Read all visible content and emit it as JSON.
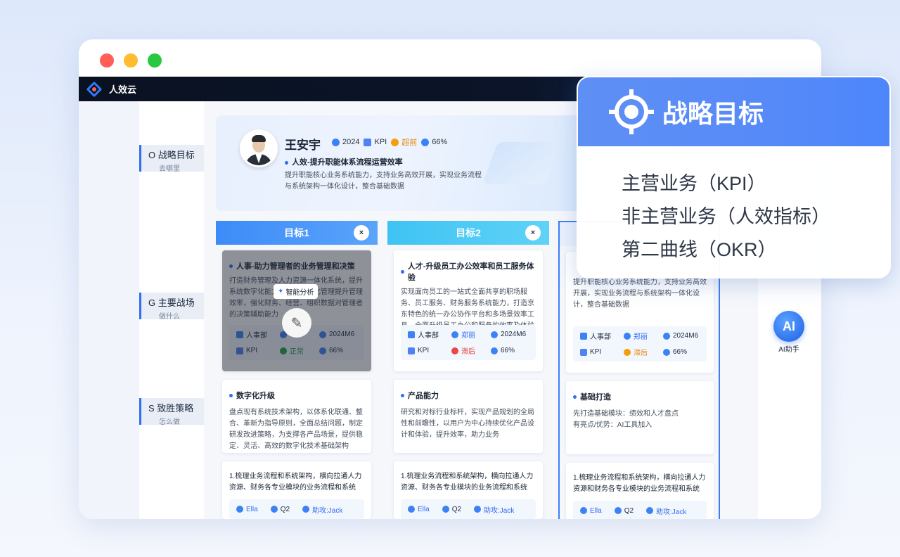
{
  "colors": {
    "close": "#ff5f57",
    "minimize": "#febc2e",
    "maximize": "#28c840",
    "accent": "#2f6df3"
  },
  "app": {
    "brand": "人效云"
  },
  "nav": [
    {
      "title": "O 战略目标",
      "sub": "去哪里"
    },
    {
      "title": "G 主要战场",
      "sub": "做什么"
    },
    {
      "title": "S 致胜策略",
      "sub": "怎么做"
    }
  ],
  "profile": {
    "name": "王安宇",
    "year": "2024",
    "kpi": "KPI",
    "status": "超前",
    "progress": "66%",
    "title": "人效-提升职能体系流程运营效率",
    "desc": "提升职能核心业务系统能力，支持业务高效开展，实现业务流程与系统架构一体化设计，整合基础数据"
  },
  "columns": [
    {
      "header": "目标1",
      "close": "×"
    },
    {
      "header": "目标2",
      "close": "×"
    }
  ],
  "goal_cards": [
    {
      "title": "人事-助力管理者的业务管理和决策",
      "desc": "打造财务管理及人力资源一体化系统，提升系统数字化能力，通过数据化管理提升管理效率，强化财务、经营、组织数据对管理者的决策辅助能力",
      "dept": "人事部",
      "owner": "",
      "date": "2024M6",
      "kpi": "KPI",
      "state": "正常",
      "pct": "66%",
      "smart": "智能分析"
    },
    {
      "title": "人才-升级员工办公效率和员工服务体验",
      "desc": "实现面向员工的一站式全面共享的职场服务、员工服务、财务服务系统能力，打造京东特色的统一办公协作平台和多场景效率工具，全面升级员工办公和服务的效率及体验",
      "dept": "人事部",
      "owner": "郑丽",
      "date": "2024M6",
      "kpi": "KPI",
      "state": "滞后",
      "pct": "66%"
    },
    {
      "desc": "提升职能核心业务系统能力，支持业务高效开展，实现业务流程与系统架构一体化设计，整合基础数据",
      "dept": "人事部",
      "owner": "郑丽",
      "date": "2024M6",
      "kpi": "KPI",
      "state": "滞后",
      "pct": "66%"
    }
  ],
  "strategy_cards": [
    {
      "title": "数字化升级",
      "desc": "盘点现有系统技术架构，以体系化联通、整合、革新为指导原则，全面总结问题，制定研发改进策略，为支撑各产品场景，提供稳定、灵活、高效的数字化技术基础架构"
    },
    {
      "title": "产品能力",
      "desc": "研究和对标行业标杆，实现产品规划的全局性和前瞻性，以用户为中心持续优化产品设计和体验，提升效率，助力业务"
    },
    {
      "title": "基础打造",
      "desc": "先打造基础模块：绩效和人才盘点\n有亮点/优势：AI工具加入"
    }
  ],
  "task_cards": [
    {
      "desc": "1.梳理业务流程和系统架构，横向拉通人力资源、财务各专业模块的业务流程和系统",
      "owner": "Ella",
      "quarter": "Q2",
      "assist": "助攻:Jack"
    },
    {
      "desc": "1.梳理业务流程和系统架构，横向拉通人力资源、财务各专业模块的业务流程和系统",
      "owner": "Ella",
      "quarter": "Q2",
      "assist": "助攻:Jack"
    },
    {
      "desc": "1.梳理业务流程和系统架构，横向拉通人力资源和财务各专业模块的业务流程和系统",
      "owner": "Ella",
      "quarter": "Q2",
      "assist": "助攻:Jack"
    }
  ],
  "ai": {
    "icon": "AI",
    "label": "AI助手"
  },
  "popup": {
    "title": "战略目标",
    "items": [
      "主营业务（KPI）",
      "非主营业务（人效指标）",
      "第二曲线（OKR）"
    ]
  }
}
